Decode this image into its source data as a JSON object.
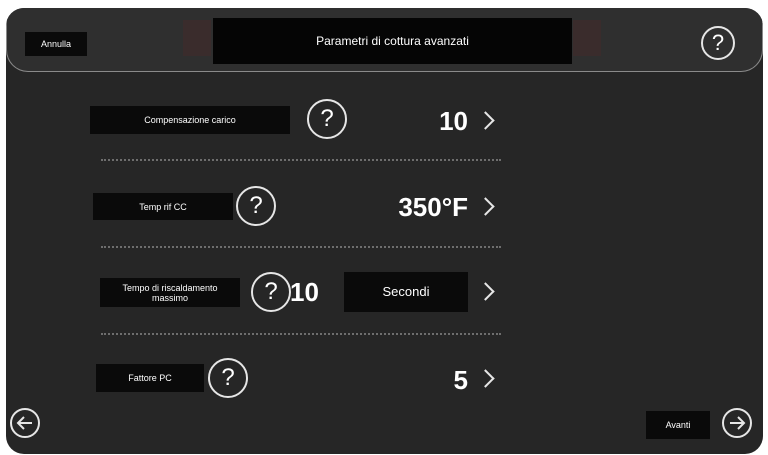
{
  "header": {
    "cancel_label": "Annulla",
    "title": "Parametri di cottura avanzati",
    "help_glyph": "?"
  },
  "rows": [
    {
      "label": "Compensazione carico",
      "value": "10"
    },
    {
      "label": "Temp rif CC",
      "value": "350°F"
    },
    {
      "label": "Tempo di riscaldamento massimo",
      "value": "10",
      "unit": "Secondi"
    },
    {
      "label": "Fattore PC",
      "value": "5"
    }
  ],
  "footer": {
    "next_label": "Avanti"
  },
  "icons": {
    "help": "question-icon",
    "chevron": "chevron-right-icon",
    "back": "arrow-left-icon",
    "forward": "arrow-right-icon"
  },
  "colors": {
    "background": "#262626",
    "button": "#0a0a0a",
    "outline": "#e6e6e6"
  }
}
